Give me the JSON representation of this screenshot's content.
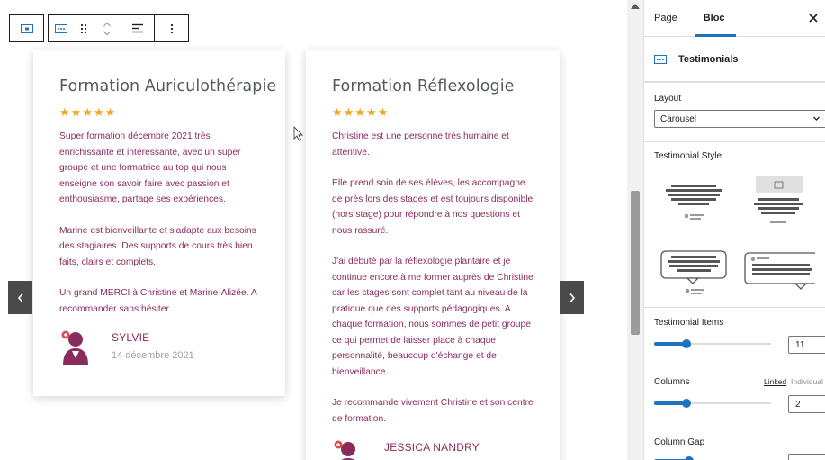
{
  "toolbar": {
    "icons": [
      "block-type-icon",
      "testimonials-icon",
      "drag-handle-icon",
      "move-up-down-icon",
      "align-icon",
      "more-options-icon"
    ]
  },
  "cards": [
    {
      "title": "Formation Auriculothérapie",
      "rating": 5,
      "paragraphs": [
        "Super formation décembre 2021 très enrichissante et intéressante, avec un super groupe et une formatrice au top qui nous enseigne son savoir faire avec passion et enthousiasme, partage ses expériences.",
        "Marine est bienveillante et s'adapte aux besoins des stagiaires. Des supports de cours très bien faits, clairs et complets.",
        "Un grand MERCI à Christine et Marine-Alizée. A recommander sans hésiter."
      ],
      "author": "SYLVIE",
      "date": "14 décembre 2021"
    },
    {
      "title": "Formation Réflexologie",
      "rating": 5,
      "paragraphs": [
        "Christine est une personne très humaine et attentive.",
        "Elle prend soin de ses élèves, les accompagne de près lors des stages et est toujours disponible (hors stage) pour répondre à nos questions et nous rassuré.",
        "J'ai débuté par la réflexologie plantaire et je continue encore à me former auprès de Christine car les stages sont complet tant au niveau de la pratique que des supports pédagogiques. A chaque formation, nous sommes de petit groupe ce qui permet de laisser place à chaque personnalité, beaucoup d'échange et de bienveillance.",
        "Je recommande vivement Christine et son centre de formation."
      ],
      "author": "JESSICA NANDRY",
      "date": ""
    }
  ],
  "sidebar": {
    "tabs": [
      "Page",
      "Bloc"
    ],
    "active_tab": "Bloc",
    "block_name": "Testimonials",
    "layout_label": "Layout",
    "layout_value": "Carousel",
    "style_label": "Testimonial Style",
    "items_label": "Testimonial Items",
    "items_value": "11",
    "items_slider_fraction": 0.28,
    "columns_label": "Columns",
    "columns_linked": "Linked",
    "columns_individual": "Individual",
    "columns_value": "2",
    "columns_slider_fraction": 0.28,
    "gap_label": "Column Gap"
  },
  "colors": {
    "accent": "#1e73be",
    "testimonial_text": "#8a2c5e",
    "star": "#f0a726",
    "avatar": "#8a2c5e"
  }
}
